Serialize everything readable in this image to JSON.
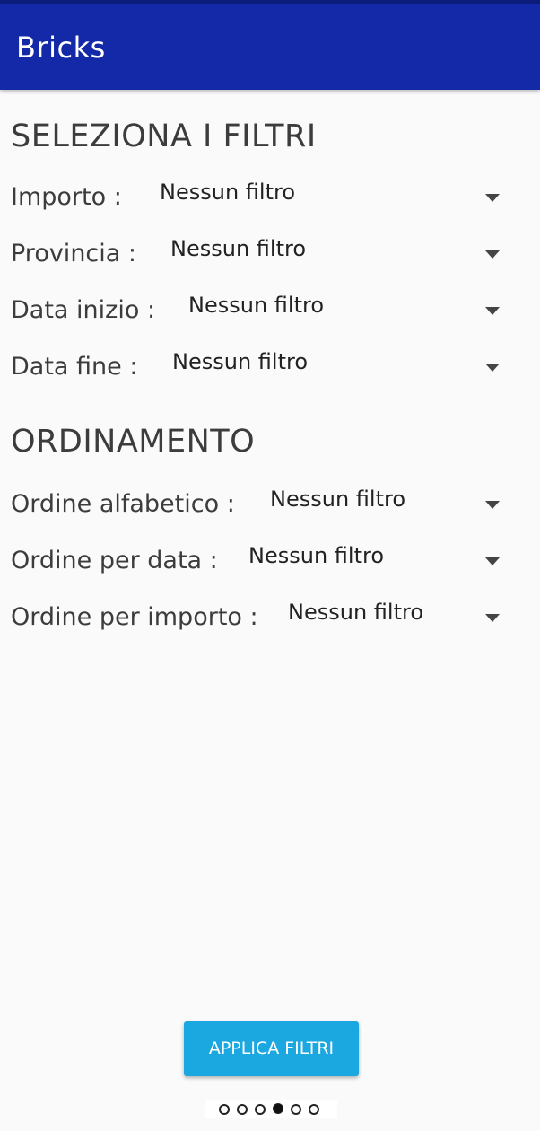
{
  "app_bar": {
    "title": "Bricks",
    "color": "#1329a8"
  },
  "filters_section": {
    "title": "SELEZIONA I FILTRI",
    "rows": [
      {
        "label": "Importo :",
        "value": "Nessun filtro"
      },
      {
        "label": "Provincia :",
        "value": "Nessun filtro"
      },
      {
        "label": "Data inizio :",
        "value": "Nessun filtro"
      },
      {
        "label": "Data fine :",
        "value": "Nessun filtro"
      }
    ]
  },
  "sort_section": {
    "title": "ORDINAMENTO",
    "rows": [
      {
        "label": "Ordine alfabetico :",
        "value": "Nessun filtro"
      },
      {
        "label": "Ordine per data :",
        "value": "Nessun filtro"
      },
      {
        "label": "Ordine per importo :",
        "value": "Nessun filtro"
      }
    ]
  },
  "apply_button": {
    "label": "APPLICA FILTRI",
    "color": "#1ba7e0"
  },
  "pager": {
    "total": 6,
    "active": 4
  }
}
